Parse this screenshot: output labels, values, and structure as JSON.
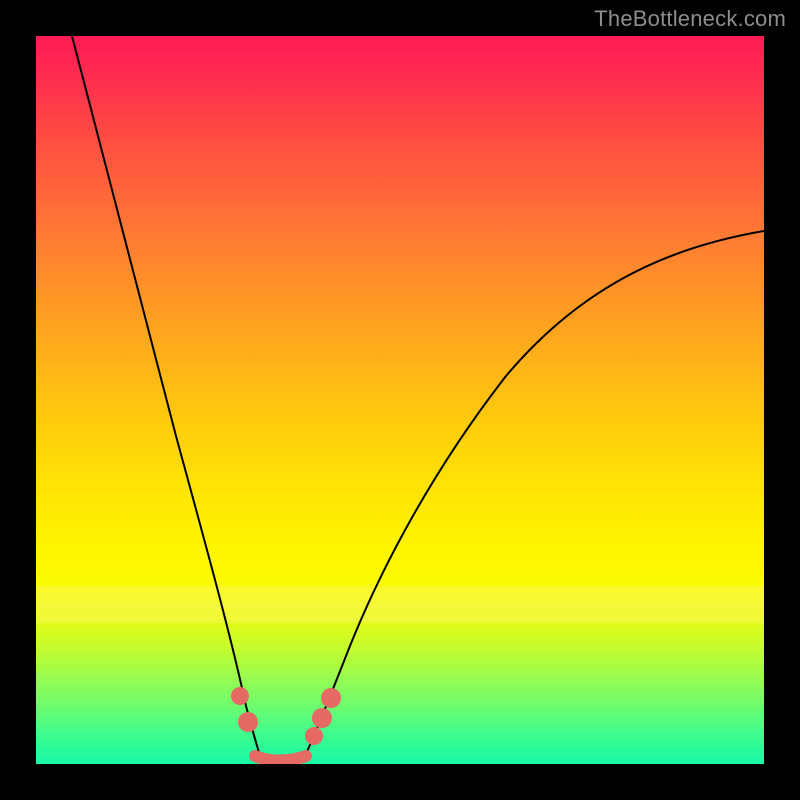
{
  "watermark": "TheBottleneck.com",
  "chart_data": {
    "type": "line",
    "title": "",
    "xlabel": "",
    "ylabel": "",
    "xlim": [
      0,
      100
    ],
    "ylim": [
      0,
      100
    ],
    "grid": false,
    "legend": false,
    "background_gradient": {
      "top_color": "#ff1a55",
      "bottom_color": "#17f8a6",
      "description": "vertical rainbow gradient red→orange→yellow→green"
    },
    "series": [
      {
        "name": "left-branch",
        "x": [
          5,
          8,
          11,
          14,
          17,
          20,
          23,
          25,
          27,
          28,
          29
        ],
        "y": [
          100,
          84,
          68,
          52,
          38,
          25,
          14,
          8,
          4,
          2,
          1
        ],
        "stroke": "#000000"
      },
      {
        "name": "right-branch",
        "x": [
          36,
          38,
          41,
          45,
          50,
          56,
          63,
          71,
          80,
          90,
          100
        ],
        "y": [
          1,
          3,
          7,
          13,
          21,
          30,
          40,
          50,
          59,
          67,
          73
        ],
        "stroke": "#000000"
      },
      {
        "name": "valley-floor",
        "x": [
          29,
          31,
          33,
          35,
          36
        ],
        "y": [
          1,
          0.5,
          0.5,
          0.7,
          1
        ],
        "stroke": "#000000"
      }
    ],
    "markers": [
      {
        "name": "left-dot-upper",
        "x": 26.2,
        "y": 9.5,
        "r": 1.4,
        "color": "#e46a63"
      },
      {
        "name": "left-dot-lower",
        "x": 27.5,
        "y": 6.0,
        "r": 1.6,
        "color": "#e46a63"
      },
      {
        "name": "right-dot-upper",
        "x": 40.0,
        "y": 8.5,
        "r": 1.6,
        "color": "#e46a63"
      },
      {
        "name": "right-dot-mid",
        "x": 38.8,
        "y": 6.0,
        "r": 1.6,
        "color": "#e46a63"
      },
      {
        "name": "right-dot-lower",
        "x": 37.6,
        "y": 3.5,
        "r": 1.4,
        "color": "#e46a63"
      },
      {
        "name": "floor-segment",
        "shape": "segment",
        "x1": 29,
        "y1": 1.0,
        "x2": 36.5,
        "y2": 1.2,
        "color": "#e46a63",
        "width": 1.6
      }
    ]
  }
}
